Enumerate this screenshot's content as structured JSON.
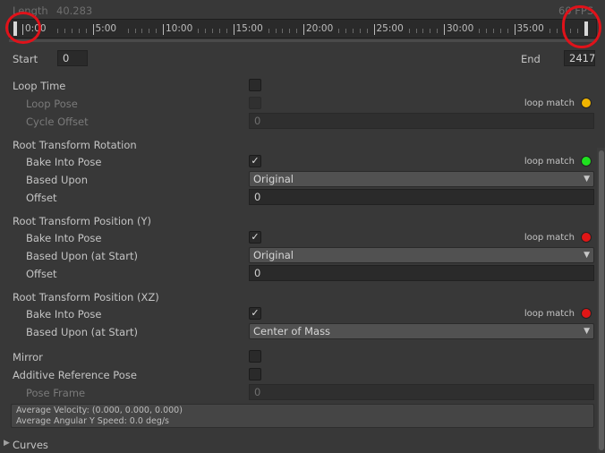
{
  "header": {
    "length_label": "Length",
    "length_value": "40.283",
    "fps": "60 FPS"
  },
  "timeline": {
    "ticks": [
      "0:00",
      "5:00",
      "10:00",
      "15:00",
      "20:00",
      "25:00",
      "30:00",
      "35:00"
    ],
    "start_handle_position": 0,
    "end_handle_position": 1
  },
  "range": {
    "start_label": "Start",
    "start_value": "0",
    "end_label": "End",
    "end_value": "2417"
  },
  "loop": {
    "loop_time_label": "Loop Time",
    "loop_pose_label": "Loop Pose",
    "cycle_offset_label": "Cycle Offset",
    "cycle_offset_value": "0",
    "loop_match_label": "loop match",
    "loop_match_color": "#f0b400"
  },
  "root_rotation": {
    "title": "Root Transform Rotation",
    "bake_label": "Bake Into Pose",
    "bake_checked": true,
    "based_upon_label": "Based Upon",
    "based_upon_value": "Original",
    "offset_label": "Offset",
    "offset_value": "0",
    "loop_match_label": "loop match",
    "loop_match_color": "#1fe01f"
  },
  "root_position_y": {
    "title": "Root Transform Position (Y)",
    "bake_label": "Bake Into Pose",
    "bake_checked": true,
    "based_upon_label": "Based Upon (at Start)",
    "based_upon_value": "Original",
    "offset_label": "Offset",
    "offset_value": "0",
    "loop_match_label": "loop match",
    "loop_match_color": "#e01616"
  },
  "root_position_xz": {
    "title": "Root Transform Position (XZ)",
    "bake_label": "Bake Into Pose",
    "bake_checked": true,
    "based_upon_label": "Based Upon (at Start)",
    "based_upon_value": "Center of Mass",
    "loop_match_label": "loop match",
    "loop_match_color": "#e01616"
  },
  "options": {
    "mirror_label": "Mirror",
    "additive_label": "Additive Reference Pose",
    "pose_frame_label": "Pose Frame",
    "pose_frame_value": "0"
  },
  "info": {
    "velocity": "Average Velocity: (0.000, 0.000, 0.000)",
    "angular": "Average Angular Y Speed: 0.0 deg/s"
  },
  "curves": {
    "label": "Curves"
  },
  "icons": {
    "checkmark": "✓",
    "dropdown_arrow": "▼",
    "foldout_arrow": "▶"
  },
  "annotation_color": "#e0121a"
}
